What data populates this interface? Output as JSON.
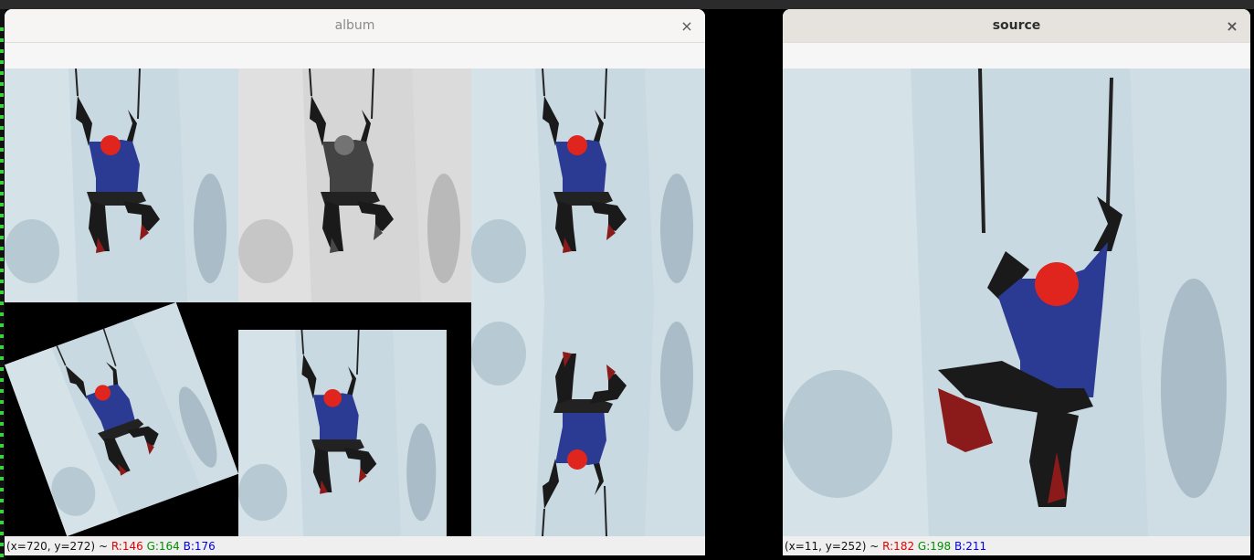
{
  "windows": {
    "album": {
      "title": "album",
      "close_glyph": "×",
      "status": {
        "coords": "(x=720, y=272)",
        "sep": " ~ ",
        "r": "R:146",
        "g": "G:164",
        "b": "B:176"
      }
    },
    "source": {
      "title": "source",
      "close_glyph": "×",
      "status": {
        "coords": "(x=11, y=252)",
        "sep": " ~ ",
        "r": "R:182",
        "g": "G:198",
        "b": "B:211"
      }
    }
  },
  "album_tiles": [
    {
      "name": "tile-original",
      "variant": "color"
    },
    {
      "name": "tile-grayscale",
      "variant": "gray"
    },
    {
      "name": "tile-flipped-vertical",
      "variant": "mirror"
    },
    {
      "name": "tile-rotated",
      "variant": "rotated"
    },
    {
      "name": "tile-scaled",
      "variant": "scaled"
    }
  ],
  "colors": {
    "ice": "#c9d9e1",
    "ice_dark": "#9fb4bf",
    "jacket": "#2b3a93",
    "helmet": "#e0251f",
    "pants": "#1a1a1a",
    "status_r": "#e00000",
    "status_g": "#009000",
    "status_b": "#0000e0"
  }
}
